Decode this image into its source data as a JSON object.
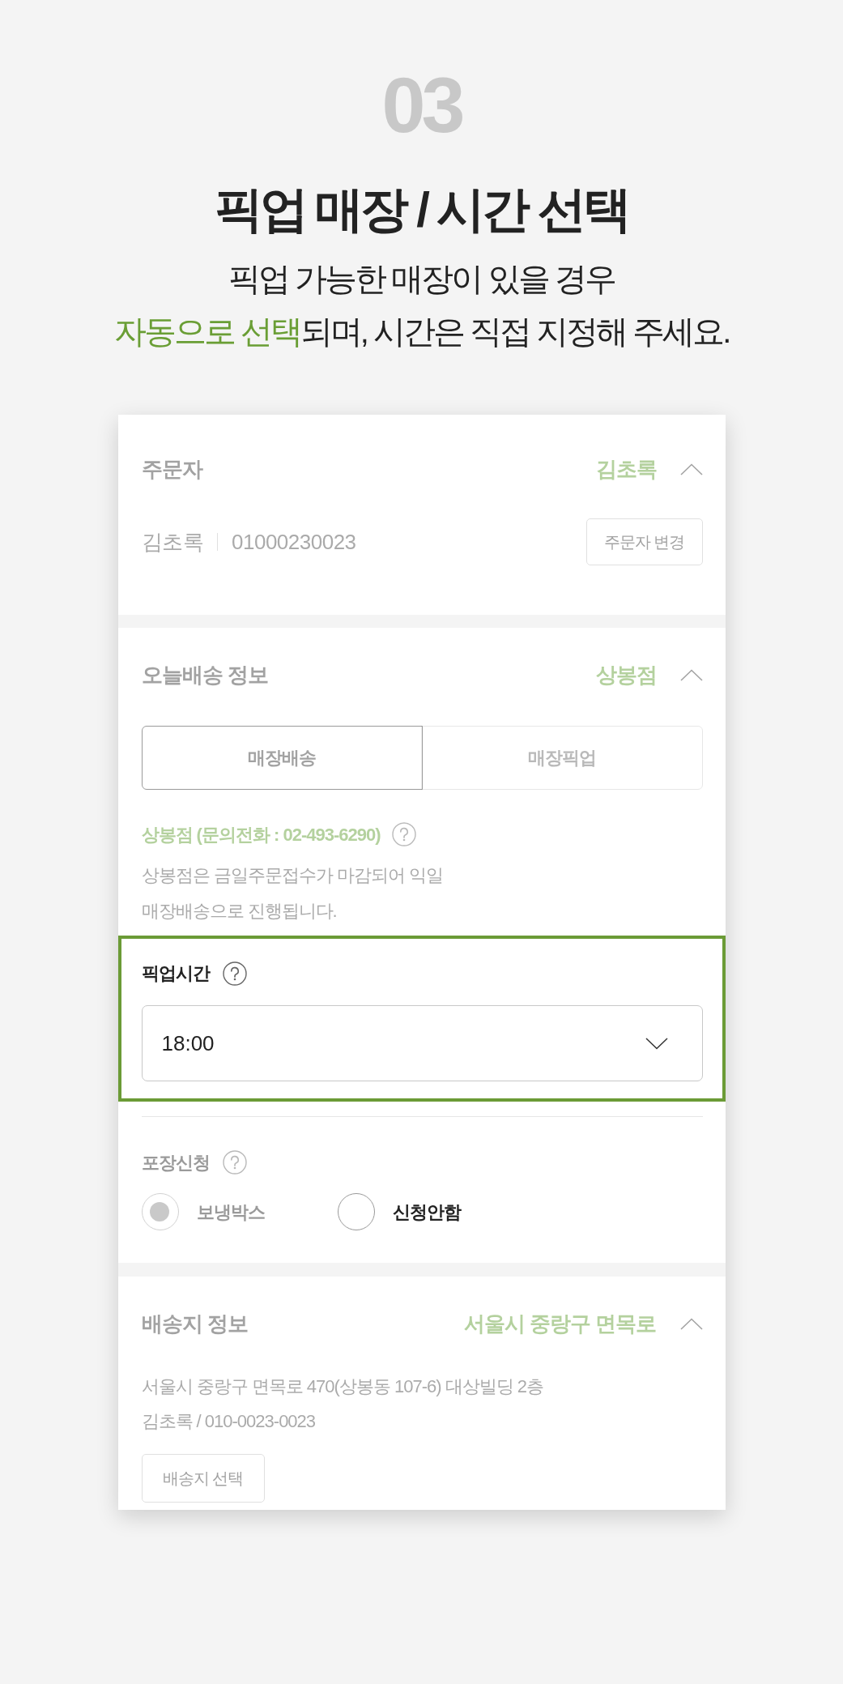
{
  "step_number": "03",
  "title": "픽업 매장 / 시간 선택",
  "description": {
    "lines": [
      [
        {
          "text": "픽업 가능한 매장이 있을 경우",
          "emphasis": false
        }
      ],
      [
        {
          "text": "자동으로 선택",
          "emphasis": true
        },
        {
          "text": "되며, 시간은 직접 지정해 주세요.",
          "emphasis": false
        }
      ]
    ]
  },
  "order_form": {
    "sections": [
      {
        "kind": "orderer",
        "title": "주문자",
        "summary": "김초록",
        "expanded": true,
        "dimmed": true,
        "orderer_name": "김초록",
        "phone": "01000230023",
        "button": "주문자 변경"
      },
      {
        "kind": "delivery",
        "title": "오늘배송 정보",
        "summary": "상봉점",
        "expanded": true,
        "dimmed": true,
        "tabs": [
          {
            "label": "매장배송",
            "selected": true
          },
          {
            "label": "매장픽업",
            "selected": false
          }
        ],
        "store": "상봉점 (문의전화 : 02-493-6290)",
        "notice_lines": [
          "상봉점은 금일주문접수가 마감되어 익일",
          "매장배송으로 진행됩니다."
        ],
        "pickup_time": {
          "label": "픽업시간",
          "value": "18:00",
          "highlighted": true
        },
        "packaging": {
          "label": "포장신청",
          "dimmed": true,
          "options": [
            {
              "label": "보냉박스",
              "selected": true,
              "dimmed": true
            },
            {
              "label": "신청안함",
              "selected": false,
              "dimmed": false
            }
          ]
        }
      },
      {
        "kind": "shipping_address",
        "title": "배송지 정보",
        "summary": "서울시 중랑구 면목로",
        "expanded": true,
        "dimmed": true,
        "address_lines": [
          "서울시 중랑구 면목로 470(상봉동 107-6) 대상빌딩 2층",
          "김초록 / 010-0023-0023"
        ],
        "button": "배송지 선택"
      }
    ]
  }
}
